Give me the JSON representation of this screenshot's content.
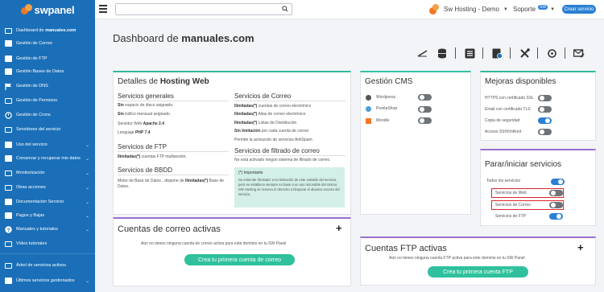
{
  "header": {
    "logo_text": "swpanel",
    "search_placeholder": "",
    "account_label": "Sw Hosting - Demo",
    "support_label": "Soporte",
    "support_badge": "SW",
    "create_button": "Crear servicio"
  },
  "sidebar": {
    "items": [
      {
        "label": "Dashboard de ",
        "label_bold": "manuales.com",
        "icon": "dashboard-icon",
        "chevron": false
      },
      {
        "label": "Gestión de Correo",
        "icon": "mail-icon",
        "chevron": false
      },
      {
        "label": "Gestión de FTP",
        "icon": "ftp-icon",
        "chevron": false
      },
      {
        "label": "Gestión Bases de Datos",
        "icon": "database-icon",
        "chevron": false
      },
      {
        "label": "Gestión de DNS",
        "icon": "flag-icon",
        "chevron": false
      },
      {
        "label": "Gestión de Permisos",
        "icon": "permissions-icon",
        "chevron": false
      },
      {
        "label": "Gestión de Crons",
        "icon": "cron-icon",
        "chevron": false
      },
      {
        "label": "Servidores del servicio",
        "icon": "server-icon",
        "chevron": false
      },
      {
        "label": "Uso del servicio",
        "icon": "usage-icon",
        "chevron": true
      },
      {
        "label": "Conservar y recuperar mis datos",
        "icon": "backup-icon",
        "chevron": true
      },
      {
        "label": "Monitorización",
        "icon": "monitor-icon",
        "chevron": true
      },
      {
        "label": "Otras acciones",
        "icon": "actions-icon",
        "chevron": true
      },
      {
        "label": "Documentación Servicio",
        "icon": "docs-icon",
        "chevron": true
      },
      {
        "label": "Pagos y Bajas",
        "icon": "payments-icon",
        "chevron": true
      },
      {
        "label": "Manuales y tutoriales",
        "icon": "help-icon",
        "chevron": true
      },
      {
        "label": "Vídeo tutoriales",
        "icon": "video-icon",
        "chevron": false
      },
      {
        "label": "Árbol de servicios activos",
        "icon": "tree-icon",
        "chevron": false
      },
      {
        "label": "Últimos servicios gestionados",
        "icon": "recent-icon",
        "chevron": true
      }
    ]
  },
  "main": {
    "title_prefix": "Dashboard de ",
    "title_bold": "manuales.com"
  },
  "hosting": {
    "title_prefix": "Detalles de ",
    "title_bold": "Hosting Web",
    "general": {
      "title": "Servicios generales",
      "rows": [
        {
          "b": "Sin",
          "t": " espacio de disco asignado."
        },
        {
          "b": "Sin",
          "t": " tráfico mensual asignado."
        },
        {
          "b": "",
          "t": "Servidor Web ",
          "b2": "Apache 2.4"
        },
        {
          "b": "",
          "t": "Lenguaje ",
          "b2": "PHP 7.4"
        }
      ]
    },
    "ftp": {
      "title": "Servicios de FTP",
      "row_b": "Ilimitadas(*)",
      "row_t": " cuentas FTP multisesión."
    },
    "bbdd": {
      "title": "Servicios de BBDD",
      "line1": "Motor de Base de Datos , dispone de ",
      "line1_b": "Ilimitadas(*)",
      "line1_end": " Base de",
      "line2": "Datos."
    },
    "mail": {
      "title": "Servicios de Correo",
      "rows": [
        {
          "b": "Ilimitadas(*)",
          "t": " cuentas de correo electrónico"
        },
        {
          "b": "Ilimitadas(*)",
          "t": " Alias de correo electrónico"
        },
        {
          "b": "Ilimitadas(*)",
          "t": " Listas de Distribución"
        },
        {
          "b": "Sin limitación",
          "t": " por cada cuenta de correo"
        },
        {
          "b": "",
          "t": "Permite la activación de servicios AntiSpam"
        }
      ]
    },
    "filter": {
      "title": "Servicios de filtrado de correo",
      "row": "No está activado ningún sistema de filtrado de correo."
    },
    "notice": {
      "title": "(*) Importante",
      "body": "Se entiende 'ilimitado' a no limitación de este variable del servicio, pero se establece siempre en base a un uso razonable del mismo. SW Hosting se reserva el derecho a bloquear el abusivo exceso del servicio."
    }
  },
  "cms": {
    "title": "Gestión CMS",
    "items": [
      {
        "label": "Wordpress",
        "on": false
      },
      {
        "label": "PrestaShop",
        "on": false
      },
      {
        "label": "Moodle",
        "on": false
      }
    ]
  },
  "upgrades": {
    "title": "Mejoras disponibles",
    "items": [
      {
        "label": "HTTPS con certificado SSL",
        "on": false
      },
      {
        "label": "Email con certificado TLS",
        "on": false
      },
      {
        "label": "Copia de seguridad",
        "on": true
      },
      {
        "label": "Acceso SSH/chRoot",
        "on": false
      }
    ]
  },
  "services": {
    "title": "Parar/iniciar servicios",
    "all_label": "Todos los servicios",
    "all_on": true,
    "items": [
      {
        "label": "Servicios de Web",
        "on": false
      },
      {
        "label": "Servicios de Correo",
        "on": false
      },
      {
        "label": "Servicios de FTP",
        "on": true
      }
    ]
  },
  "mail_accounts": {
    "title": "Cuentas de correo activas",
    "empty": "Aún no tienes ninguna cuenta de correo activa para este dominio en tu SW Panel",
    "button": "Crea tu primera cuenta de correo"
  },
  "ftp_accounts": {
    "title": "Cuentas FTP activas",
    "empty": "Aún no tienes ninguna cuenta FTP activa para este dominio en tu SW Panel",
    "button": "Crea tu primera cuenta FTP"
  },
  "colors": {
    "brand": "#1a6fb8",
    "accent": "#2a7fd4",
    "teal": "#2fb99a",
    "highlight": "#d9262f"
  }
}
